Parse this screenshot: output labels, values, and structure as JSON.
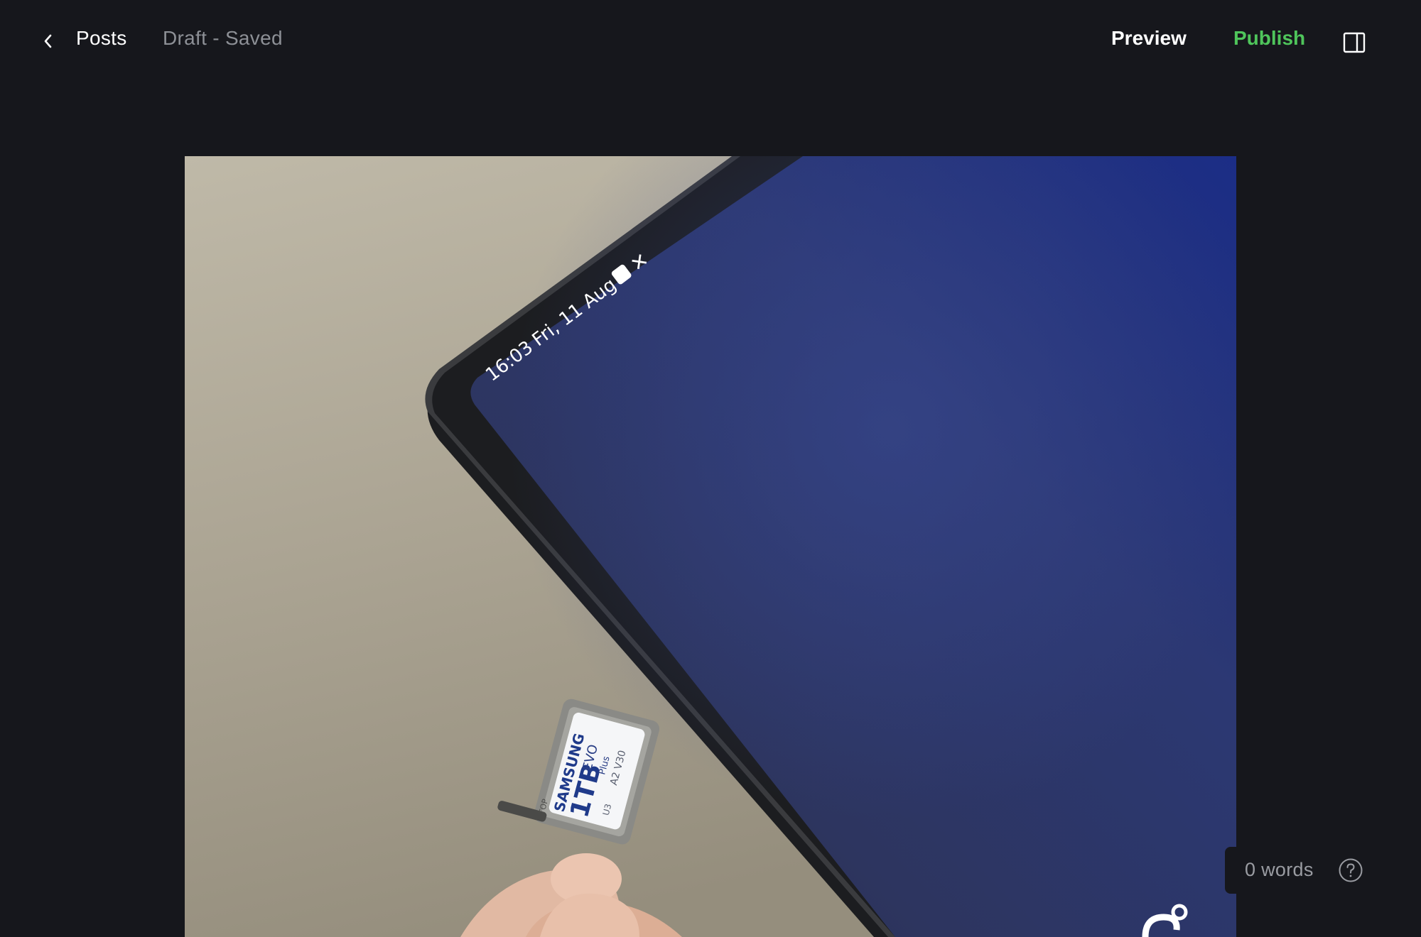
{
  "header": {
    "back_icon": "chevron-left-icon",
    "posts_label": "Posts",
    "status": "Draft - Saved",
    "preview_label": "Preview",
    "publish_label": "Publish",
    "sidebar_icon": "sidebar-panel-icon",
    "publish_color": "#4fc55b"
  },
  "feature_image": {
    "screen_time": "16:03",
    "screen_date": "Fri, 11 Aug",
    "card_brand": "SAMSUNG",
    "card_capacity": "1TB",
    "card_line": "EVO",
    "card_line_sub": "Plus",
    "card_specs": "A2 V30",
    "card_class": "U3",
    "tray_text": "TOP"
  },
  "footer": {
    "word_count": "0 words",
    "help_icon": "question-circle-icon"
  }
}
